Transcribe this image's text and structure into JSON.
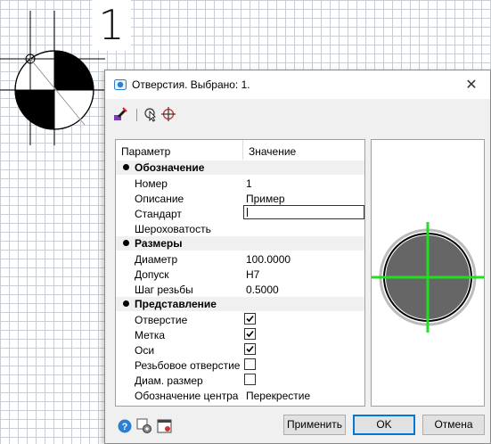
{
  "canvas": {
    "sheet_number": "1"
  },
  "dialog": {
    "title": "Отверстия. Выбрано: 1.",
    "close_symbol": "✕",
    "toolbar": {
      "icons": [
        "brush-edit-icon",
        "select-cursor-icon",
        "target-icon"
      ]
    },
    "grid": {
      "header": {
        "param": "Параметр",
        "value": "Значение"
      },
      "sections": [
        {
          "title": "Обозначение",
          "rows": [
            {
              "param": "Номер",
              "value": "1"
            },
            {
              "param": "Описание",
              "value": "Пример"
            },
            {
              "param": "Стандарт",
              "value": "",
              "type": "input"
            },
            {
              "param": "Шероховатость",
              "value": ""
            }
          ]
        },
        {
          "title": "Размеры",
          "rows": [
            {
              "param": "Диаметр",
              "value": "100.0000"
            },
            {
              "param": "Допуск",
              "value": "H7"
            },
            {
              "param": "Шаг резьбы",
              "value": "0.5000"
            }
          ]
        },
        {
          "title": "Представление",
          "rows": [
            {
              "param": "Отверстие",
              "checked": true
            },
            {
              "param": "Метка",
              "checked": true
            },
            {
              "param": "Оси",
              "checked": true
            },
            {
              "param": "Резьбовое отверстие",
              "checked": false
            },
            {
              "param": "Диам. размер",
              "checked": false
            },
            {
              "param": "Обозначение центра",
              "value": "Перекрестие"
            }
          ]
        }
      ]
    },
    "buttons": {
      "apply": "Применить",
      "ok": "OK",
      "cancel": "Отмена"
    },
    "colors": {
      "accent": "#0078d7",
      "preview_axes": "#22dd22",
      "preview_fill": "#666666"
    }
  }
}
